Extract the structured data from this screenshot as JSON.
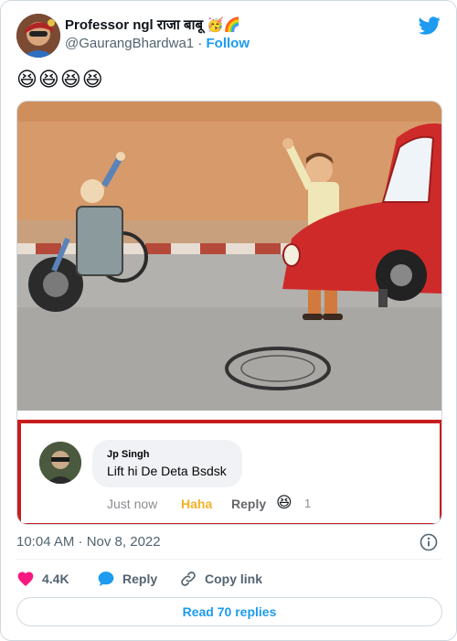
{
  "author": {
    "display_name": "Professor ngl राजा बाबू 🥳🌈",
    "handle": "@GaurangBhardwa1",
    "separator": "·",
    "follow_label": "Follow"
  },
  "tweet": {
    "text": "😆😆😆😆"
  },
  "embedded_comment": {
    "author": "Jp Singh",
    "text": "Lift hi De Deta Bsdsk",
    "time": "Just now",
    "reaction_label": "Haha",
    "reply_label": "Reply",
    "reaction_emoji": "😆",
    "reaction_count": "1"
  },
  "meta": {
    "timestamp": "10:04 AM · Nov 8, 2022"
  },
  "actions": {
    "likes": "4.4K",
    "reply": "Reply",
    "copy_link": "Copy link"
  },
  "footer": {
    "read_replies": "Read 70 replies"
  },
  "colors": {
    "accent": "#1d9bf0",
    "like": "#f91880",
    "comment_border": "#c81d1d"
  }
}
